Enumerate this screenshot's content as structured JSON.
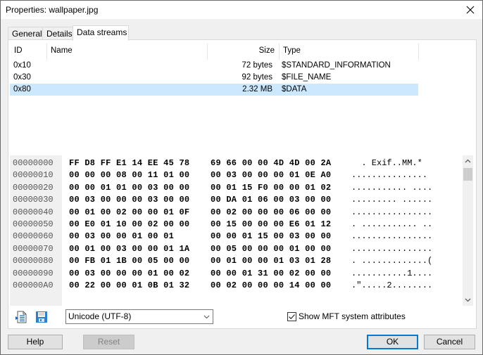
{
  "window": {
    "title": "Properties: wallpaper.jpg",
    "close_icon": "close-icon"
  },
  "tabs": [
    {
      "label": "General",
      "active": false
    },
    {
      "label": "Details",
      "active": false
    },
    {
      "label": "Data streams",
      "active": true
    }
  ],
  "streams": {
    "columns": {
      "id": "ID",
      "name": "Name",
      "size": "Size",
      "type": "Type"
    },
    "rows": [
      {
        "id": "0x10",
        "name": "",
        "size": "72 bytes",
        "type": "$STANDARD_INFORMATION",
        "selected": false
      },
      {
        "id": "0x30",
        "name": "",
        "size": "92 bytes",
        "type": "$FILE_NAME",
        "selected": false
      },
      {
        "id": "0x80",
        "name": "",
        "size": "2.32 MB",
        "type": "$DATA",
        "selected": true
      }
    ]
  },
  "hex": {
    "lines": [
      {
        "addr": "00000000",
        "b1": "FF D8 FF E1 14 EE 45 78",
        "b2": "69 66 00 00 4D 4D 00 2A",
        "ascii": "  . Exif..MM.*"
      },
      {
        "addr": "00000010",
        "b1": "00 00 00 08 00 11 01 00",
        "b2": "00 03 00 00 00 01 0E A0",
        "ascii": "..............."
      },
      {
        "addr": "00000020",
        "b1": "00 00 01 01 00 03 00 00",
        "b2": "00 01 15 F0 00 00 01 02",
        "ascii": "........... ...."
      },
      {
        "addr": "00000030",
        "b1": "00 03 00 00 00 03 00 00",
        "b2": "00 DA 01 06 00 03 00 00",
        "ascii": "......... ......"
      },
      {
        "addr": "00000040",
        "b1": "00 01 00 02 00 00 01 0F",
        "b2": "00 02 00 00 00 06 00 00",
        "ascii": "................"
      },
      {
        "addr": "00000050",
        "b1": "00 E0 01 10 00 02 00 00",
        "b2": "00 15 00 00 00 E6 01 12",
        "ascii": ". ........... .."
      },
      {
        "addr": "00000060",
        "b1": "00 03 00 00 01 00 01",
        "b2": "00 00 01 15 00 03 00 00",
        "ascii": "................"
      },
      {
        "addr": "00000070",
        "b1": "00 01 00 03 00 00 01 1A",
        "b2": "00 05 00 00 00 01 00 00",
        "ascii": "................"
      },
      {
        "addr": "00000080",
        "b1": "00 FB 01 1B 00 05 00 00",
        "b2": "00 01 00 00 01 03 01 28",
        "ascii": ". .............("
      },
      {
        "addr": "00000090",
        "b1": "00 03 00 00 00 01 00 02",
        "b2": "00 00 01 31 00 02 00 00",
        "ascii": "...........1...."
      },
      {
        "addr": "000000A0",
        "b1": "00 22 00 00 01 0B 01 32",
        "b2": "00 02 00 00 00 14 00 00",
        "ascii": ".\".....2........"
      }
    ],
    "scroll_up_icon": "chevron-up-icon",
    "scroll_down_icon": "chevron-down-icon"
  },
  "tools": {
    "encoding": {
      "selected": "Unicode (UTF-8)"
    },
    "show_mft": {
      "label": "Show MFT system attributes",
      "checked": true
    }
  },
  "buttons": {
    "help": "Help",
    "reset": "Reset",
    "ok": "OK",
    "cancel": "Cancel"
  }
}
